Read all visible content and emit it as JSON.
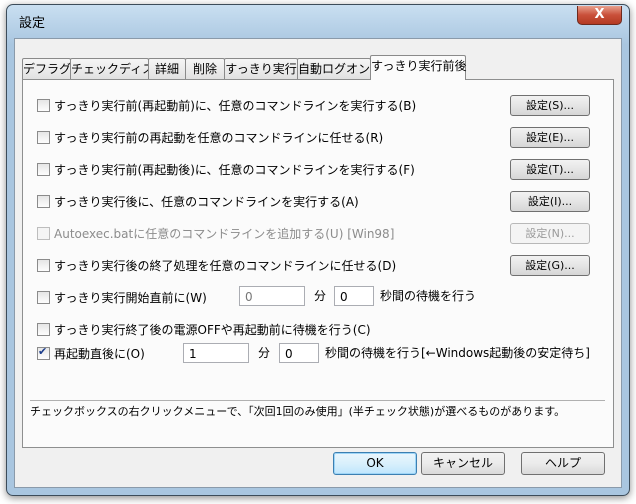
{
  "window": {
    "title": "設定",
    "close_label": "X"
  },
  "tabs": [
    {
      "label": "デフラグ",
      "active": false
    },
    {
      "label": "チェックディスク",
      "active": false
    },
    {
      "label": "詳細",
      "active": false
    },
    {
      "label": "削除",
      "active": false
    },
    {
      "label": "すっきり実行",
      "active": false
    },
    {
      "label": "自動ログオン",
      "active": false
    },
    {
      "label": "すっきり実行前後",
      "active": true
    }
  ],
  "options": [
    {
      "label": "すっきり実行前(再起動前)に、任意のコマンドラインを実行する(B)",
      "checked": false,
      "enabled": true,
      "button": "設定(S)..."
    },
    {
      "label": "すっきり実行前の再起動を任意のコマンドラインに任せる(R)",
      "checked": false,
      "enabled": true,
      "button": "設定(E)..."
    },
    {
      "label": "すっきり実行前(再起動後)に、任意のコマンドラインを実行する(F)",
      "checked": false,
      "enabled": true,
      "button": "設定(T)..."
    },
    {
      "label": "すっきり実行後に、任意のコマンドラインを実行する(A)",
      "checked": false,
      "enabled": true,
      "button": "設定(I)..."
    },
    {
      "label": "Autoexec.batに任意のコマンドラインを追加する(U) [Win98]",
      "checked": false,
      "enabled": false,
      "button": "設定(N)..."
    },
    {
      "label": "すっきり実行後の終了処理を任意のコマンドラインに任せる(D)",
      "checked": false,
      "enabled": true,
      "button": "設定(G)..."
    }
  ],
  "wait_before": {
    "label": "すっきり実行開始直前に(W)",
    "checked": false,
    "minutes": "0",
    "minutes_unit": "分",
    "seconds": "0",
    "seconds_suffix": "秒間の待機を行う"
  },
  "wait_shutdown": {
    "label": "すっきり実行終了後の電源OFFや再起動前に待機を行う(C)",
    "checked": false
  },
  "wait_restart": {
    "label": "再起動直後に(O)",
    "checked": true,
    "minutes": "1",
    "minutes_unit": "分",
    "seconds": "0",
    "seconds_suffix": "秒間の待機を行う[←Windows起動後の安定待ち]"
  },
  "note": "チェックボックスの右クリックメニューで、「次回1回のみ使用」(半チェック状態)が選べるものがあります。",
  "footer": {
    "ok": "OK",
    "cancel": "キャンセル",
    "help": "ヘルプ"
  }
}
